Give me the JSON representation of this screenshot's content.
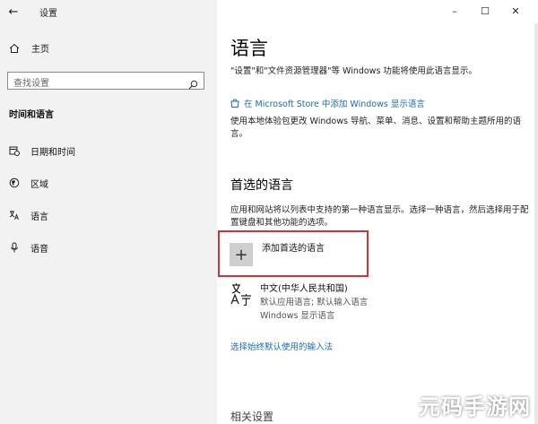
{
  "window": {
    "title": "设置",
    "controls": {
      "minimize": "–",
      "maximize": "☐",
      "close": "✕"
    },
    "back": "←"
  },
  "sidebar": {
    "home_label": "主页",
    "search_placeholder": "查找设置",
    "section_title": "时间和语言",
    "items": [
      {
        "label": "日期和时间",
        "icon": "calendar-clock-icon"
      },
      {
        "label": "区域",
        "icon": "globe-region-icon"
      },
      {
        "label": "语言",
        "icon": "language-icon",
        "active": true
      },
      {
        "label": "语音",
        "icon": "microphone-icon"
      }
    ]
  },
  "main": {
    "title": "语言",
    "display_desc": "\"设置\"和\"文件资源管理器\"等 Windows 功能将使用此语言显示。",
    "store_link": "在 Microsoft Store 中添加 Windows 显示语言",
    "local_exp_desc": "使用本地体验包更改 Windows 导航、菜单、消息、设置和帮助主题所用的语言。",
    "preferred_heading": "首选的语言",
    "preferred_desc": "应用和网站将以列表中支持的第一种语言显示。选择一种语言，然后选择用于配置键盘和其他功能的选项。",
    "add_language_label": "添加首选的语言",
    "languages": [
      {
        "name": "中文(中华人民共和国)",
        "sub1": "默认应用语言; 默认输入语言",
        "sub2": "Windows 显示语言"
      }
    ],
    "input_method_link": "选择始终默认使用的输入法",
    "related_heading": "相关设置"
  },
  "colors": {
    "accent": "#1a6bb8",
    "highlight_box": "#d13438",
    "sidebar_bg": "#f2f2f2"
  },
  "watermark": "元码手游网"
}
